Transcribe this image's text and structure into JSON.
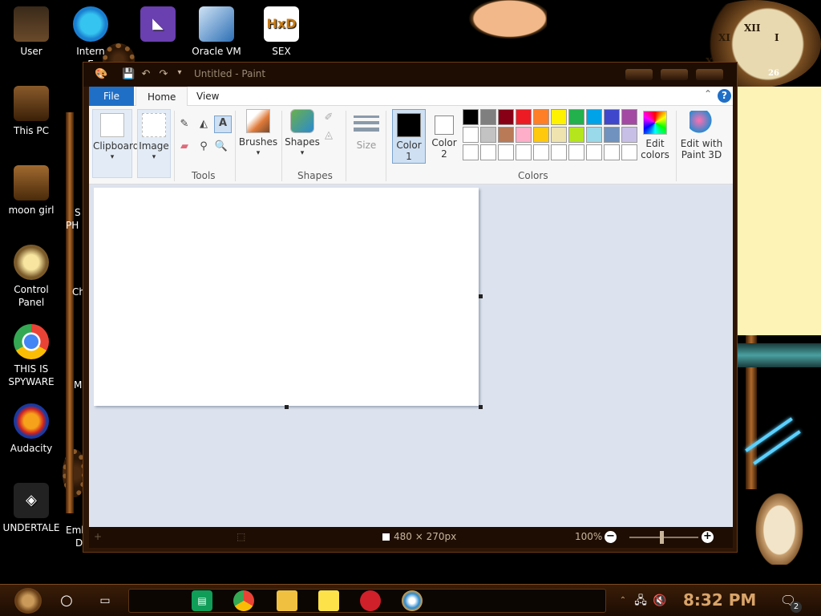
{
  "desktop": {
    "icons": [
      {
        "label": "User",
        "icon": "user-statue-icon"
      },
      {
        "label": "Intern\nE",
        "icon": "edge-icon"
      },
      {
        "label": "",
        "icon": "visual-studio-icon"
      },
      {
        "label": "Oracle VM",
        "icon": "virtualbox-icon"
      },
      {
        "label": "SEX",
        "icon": "hxd-icon"
      },
      {
        "label": "This PC",
        "icon": "computer-icon"
      },
      {
        "label": "moon girl",
        "icon": "book-icon"
      },
      {
        "label": "Control Panel",
        "icon": "lightbulb-icon"
      },
      {
        "label": "THIS IS SPYWARE",
        "icon": "chrome-icon"
      },
      {
        "label": "Audacity",
        "icon": "audacity-icon"
      },
      {
        "label": "UNDERTALE",
        "icon": "unity-icon"
      }
    ],
    "partial_labels": [
      "S",
      "PH",
      "Ch",
      "M",
      "Emb",
      "D"
    ],
    "hxd_logo_text": "HxD"
  },
  "paint": {
    "title": "Untitled - Paint",
    "tabs": {
      "file": "File",
      "home": "Home",
      "view": "View"
    },
    "help": "?",
    "groups": {
      "clipboard": "Clipboard",
      "image": "Image",
      "tools": "Tools",
      "brushes": "Brushes",
      "shapes_btn": "Shapes",
      "shapes": "Shapes",
      "size": "Size",
      "color1": "Color\n1",
      "color2": "Color\n2",
      "colors": "Colors",
      "edit_colors": "Edit\ncolors",
      "edit_paint3d": "Edit with\nPaint 3D"
    },
    "text_tool_glyph": "A",
    "palette_row1": [
      "#000000",
      "#7f7f7f",
      "#880015",
      "#ed1c24",
      "#ff7f27",
      "#fff200",
      "#22b14c",
      "#00a2e8",
      "#3f48cc",
      "#a349a4"
    ],
    "palette_row2": [
      "#ffffff",
      "#c3c3c3",
      "#b97a57",
      "#ffaec9",
      "#ffc90e",
      "#efe4b0",
      "#b5e61d",
      "#99d9ea",
      "#7092be",
      "#c8bfe7"
    ],
    "palette_row3": [
      "#ffffff",
      "#ffffff",
      "#ffffff",
      "#ffffff",
      "#ffffff",
      "#ffffff",
      "#ffffff",
      "#ffffff",
      "#ffffff",
      "#ffffff"
    ],
    "color1_value": "#000000",
    "color2_value": "#ffffff",
    "status": {
      "dimensions": "480 × 270px",
      "zoom": "100%",
      "minus": "−",
      "plus": "+"
    }
  },
  "clock_dial": {
    "numbers": [
      "XII",
      "XI",
      "X",
      "I"
    ],
    "day": "26"
  },
  "taskbar": {
    "time": "8:32 PM",
    "notification_count": "2",
    "apps": [
      "sheets-icon",
      "chrome-icon",
      "file-explorer-icon",
      "sticky-notes-icon",
      "red-app-icon",
      "paint-icon"
    ]
  }
}
